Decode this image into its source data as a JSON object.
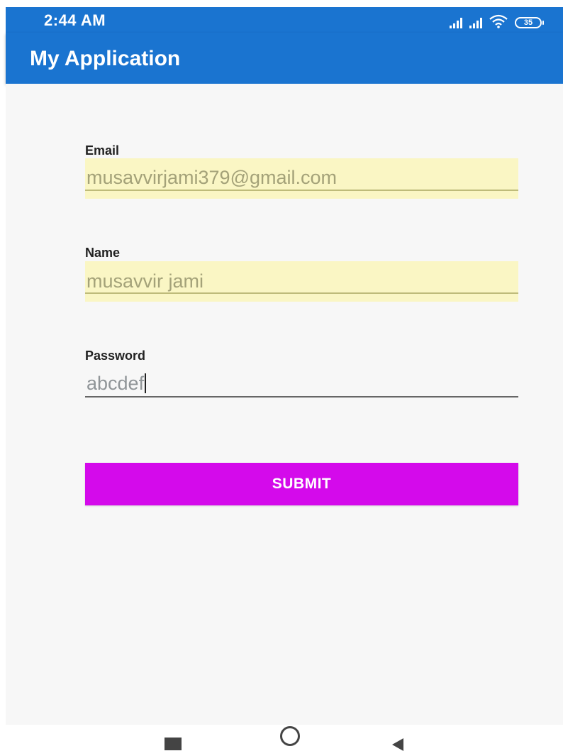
{
  "status_bar": {
    "time": "2:44 AM",
    "battery_level": "35",
    "icons": [
      "signal-icon",
      "signal-icon",
      "wifi-icon",
      "battery-icon"
    ]
  },
  "app_bar": {
    "title": "My Application",
    "color": "#1a74d0"
  },
  "form": {
    "email": {
      "label": "Email",
      "value": "musavvirjami379@gmail.com"
    },
    "name": {
      "label": "Name",
      "value": "musavvir jami"
    },
    "password": {
      "label": "Password",
      "value": "abcdef"
    },
    "submit_label": "SUBMIT",
    "submit_color": "#d40aeb",
    "autofill_color": "#faf6c4"
  },
  "nav_bar": {
    "icons": [
      "recent-apps-icon",
      "home-icon",
      "back-icon"
    ]
  }
}
